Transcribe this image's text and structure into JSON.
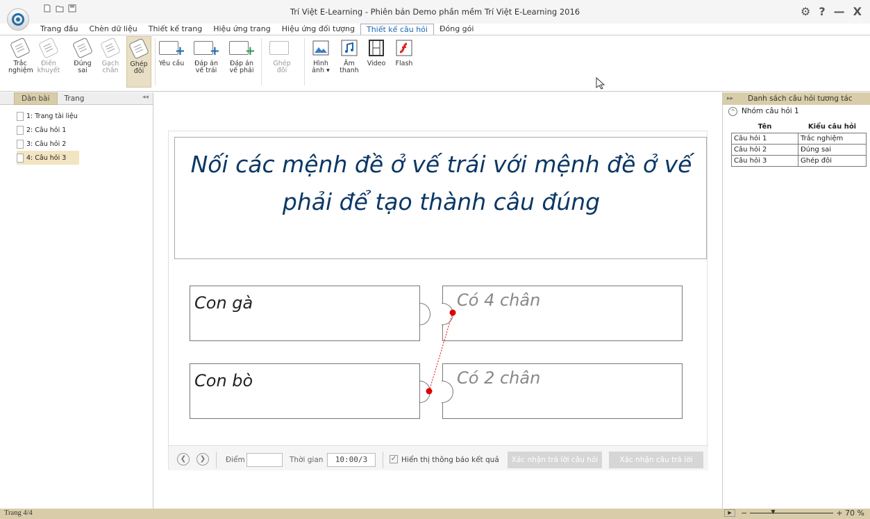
{
  "window": {
    "title": "Trí Việt E-Learning - Phiên bản Demo phần mềm Trí Việt E-Learning 2016"
  },
  "titlebar": {
    "settings_glyph": "⚙",
    "help_glyph": "?",
    "minimize_glyph": "—",
    "close_glyph": "X"
  },
  "tabs": [
    "Trang đầu",
    "Chèn dữ liệu",
    "Thiết kế trang",
    "Hiệu ứng trang",
    "Hiệu ứng đối tượng",
    "Thiết kế câu hỏi",
    "Đóng gói"
  ],
  "active_tab": "Thiết kế câu hỏi",
  "ribbon": {
    "trac": [
      "Trắc",
      "nghiệm"
    ],
    "dien": [
      "Điền",
      "khuyết"
    ],
    "dung": [
      "Đúng",
      "sai"
    ],
    "gach": [
      "Gạch",
      "chân"
    ],
    "ghep": [
      "Ghép",
      "đôi"
    ],
    "yeucau": "Yêu cầu",
    "datrai": [
      "Đáp án",
      "vế trái"
    ],
    "daphai": [
      "Đáp án",
      "vế phải"
    ],
    "ghep2": [
      "Ghép",
      "đôi"
    ],
    "hinh": [
      "Hình",
      "ảnh ▾"
    ],
    "am": [
      "Âm",
      "thanh"
    ],
    "video": "Video",
    "flash": "Flash"
  },
  "left_panel": {
    "tabs": [
      "Dàn bài",
      "Trang"
    ],
    "items": [
      "1: Trang tài liệu",
      "2: Câu hỏi 1",
      "3: Câu hỏi 2",
      "4: Câu hỏi 3"
    ],
    "selected_index": 3
  },
  "right_panel": {
    "title": "Danh sách câu hỏi tương tác",
    "group": "Nhóm câu hỏi 1",
    "headers": [
      "Tên",
      "Kiểu câu hỏi"
    ],
    "rows": [
      [
        "Câu hỏi 1",
        "Trắc nghiệm"
      ],
      [
        "Câu hỏi 2",
        "Đúng sai"
      ],
      [
        "Câu hỏi 3",
        "Ghép đôi"
      ]
    ]
  },
  "question": {
    "text_line1": "Nối các mệnh đề ở vế trái với mệnh đề ở vế",
    "text_line2": "phải để tạo thành câu đúng",
    "pairs": [
      {
        "left": "Con gà",
        "right": "Có 4 chân"
      },
      {
        "left": "Con bò",
        "right": "Có 2 chân"
      }
    ]
  },
  "question_bar": {
    "score_label": "Điểm",
    "score_value": "",
    "time_label": "Thời gian",
    "time_value": "10:00/3",
    "show_result_label": "Hiển thị thông báo kết quả",
    "show_result_checked": true,
    "confirm_question_button": "Xác nhận trả lời câu hỏi",
    "confirm_answer_button": "Xác nhận câu trả lời"
  },
  "statusbar": {
    "page": "Trang 4/4",
    "zoom_minus": "−",
    "zoom_plus": "+ 70 %",
    "zoom_level": 0.7
  },
  "colors": {
    "accent": "#1a66b3",
    "question_text": "#0b3764",
    "link": "#e00000",
    "panel_header": "#d9cda9"
  }
}
